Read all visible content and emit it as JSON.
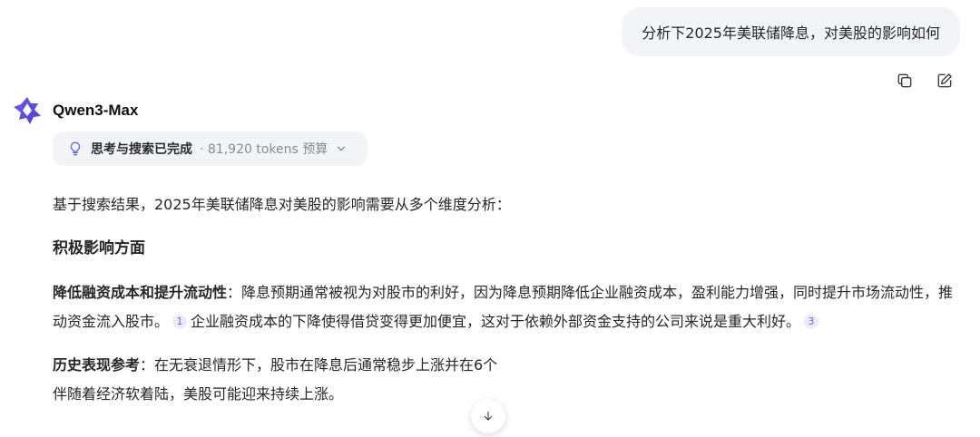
{
  "user_message": {
    "text": "分析下2025年美联储降息，对美股的影响如何"
  },
  "message_actions": {
    "copy_icon": "copy-icon",
    "edit_icon": "edit-icon"
  },
  "assistant": {
    "model_name": "Qwen3-Max",
    "logo_icon": "qwen-logo-icon",
    "thinking": {
      "status": "思考与搜索已完成",
      "meta": "· 81,920 tokens 预算",
      "icon": "lightbulb-icon"
    }
  },
  "answer": {
    "intro": "基于搜索结果，2025年美联储降息对美股的影响需要从多个维度分析：",
    "heading": "积极影响方面",
    "point1": {
      "title": "降低融资成本和提升流动性",
      "colon": "：",
      "text_a": "降息预期通常被视为对股市的利好，因为降息预期降低企业融资成本，盈利能力增强，同时提升市场流动性，推动资金流入股市。",
      "cite_a": "1",
      "text_b": "企业融资成本的下降使得借贷变得更加便宜，这对于依赖外部资金支持的公司来说是重大利好。",
      "cite_b": "3"
    },
    "point2": {
      "title": "历史表现参考",
      "colon": "：",
      "text_a": "在无衰退情形下，股市在降息后通常稳步上涨并在6个",
      "text_b": "伴随着经济软着陆，美股可能迎来持续上涨。"
    }
  },
  "scroll_button": {
    "icon": "arrow-down-icon"
  },
  "colors": {
    "accent": "#4f5fe8",
    "citation_bg": "#eceafe",
    "citation_text": "#6c63e6",
    "bubble_bg": "#f3f4f7"
  }
}
